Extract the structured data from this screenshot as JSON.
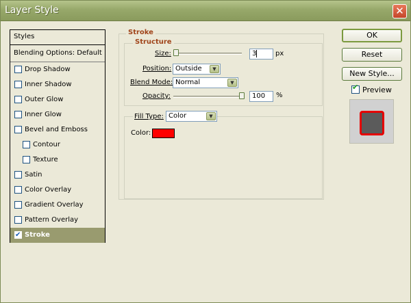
{
  "window": {
    "title": "Layer Style",
    "close_glyph": "✕"
  },
  "styles_panel": {
    "header": "Styles",
    "blending_options": "Blending Options: Default",
    "items": [
      {
        "label": "Drop Shadow",
        "checked": false,
        "indent": 0,
        "selected": false
      },
      {
        "label": "Inner Shadow",
        "checked": false,
        "indent": 0,
        "selected": false
      },
      {
        "label": "Outer Glow",
        "checked": false,
        "indent": 0,
        "selected": false
      },
      {
        "label": "Inner Glow",
        "checked": false,
        "indent": 0,
        "selected": false
      },
      {
        "label": "Bevel and Emboss",
        "checked": false,
        "indent": 0,
        "selected": false
      },
      {
        "label": "Contour",
        "checked": false,
        "indent": 1,
        "selected": false
      },
      {
        "label": "Texture",
        "checked": false,
        "indent": 1,
        "selected": false
      },
      {
        "label": "Satin",
        "checked": false,
        "indent": 0,
        "selected": false
      },
      {
        "label": "Color Overlay",
        "checked": false,
        "indent": 0,
        "selected": false
      },
      {
        "label": "Gradient Overlay",
        "checked": false,
        "indent": 0,
        "selected": false
      },
      {
        "label": "Pattern Overlay",
        "checked": false,
        "indent": 0,
        "selected": false
      },
      {
        "label": "Stroke",
        "checked": true,
        "indent": 0,
        "selected": true
      }
    ]
  },
  "stroke": {
    "title": "Stroke",
    "structure_title": "Structure",
    "size": {
      "label": "Size:",
      "value": "3",
      "unit": "px",
      "slider_fraction": 0.0
    },
    "position": {
      "label": "Position:",
      "value": "Outside"
    },
    "blend_mode": {
      "label": "Blend Mode:",
      "value": "Normal"
    },
    "opacity": {
      "label": "Opacity:",
      "value": "100",
      "unit": "%",
      "slider_fraction": 1.0
    },
    "fill_type": {
      "label": "Fill Type:",
      "value": "Color"
    },
    "color": {
      "label": "Color:",
      "swatch": "#ff0000"
    }
  },
  "buttons": {
    "ok": "OK",
    "reset": "Reset",
    "new_style": "New Style...",
    "preview_label": "Preview",
    "preview_checked": true
  },
  "colors": {
    "selected_row": "#999b6f",
    "section_title": "#a0451b",
    "preview_fill": "#5b5b5b",
    "preview_stroke": "#e60000"
  }
}
